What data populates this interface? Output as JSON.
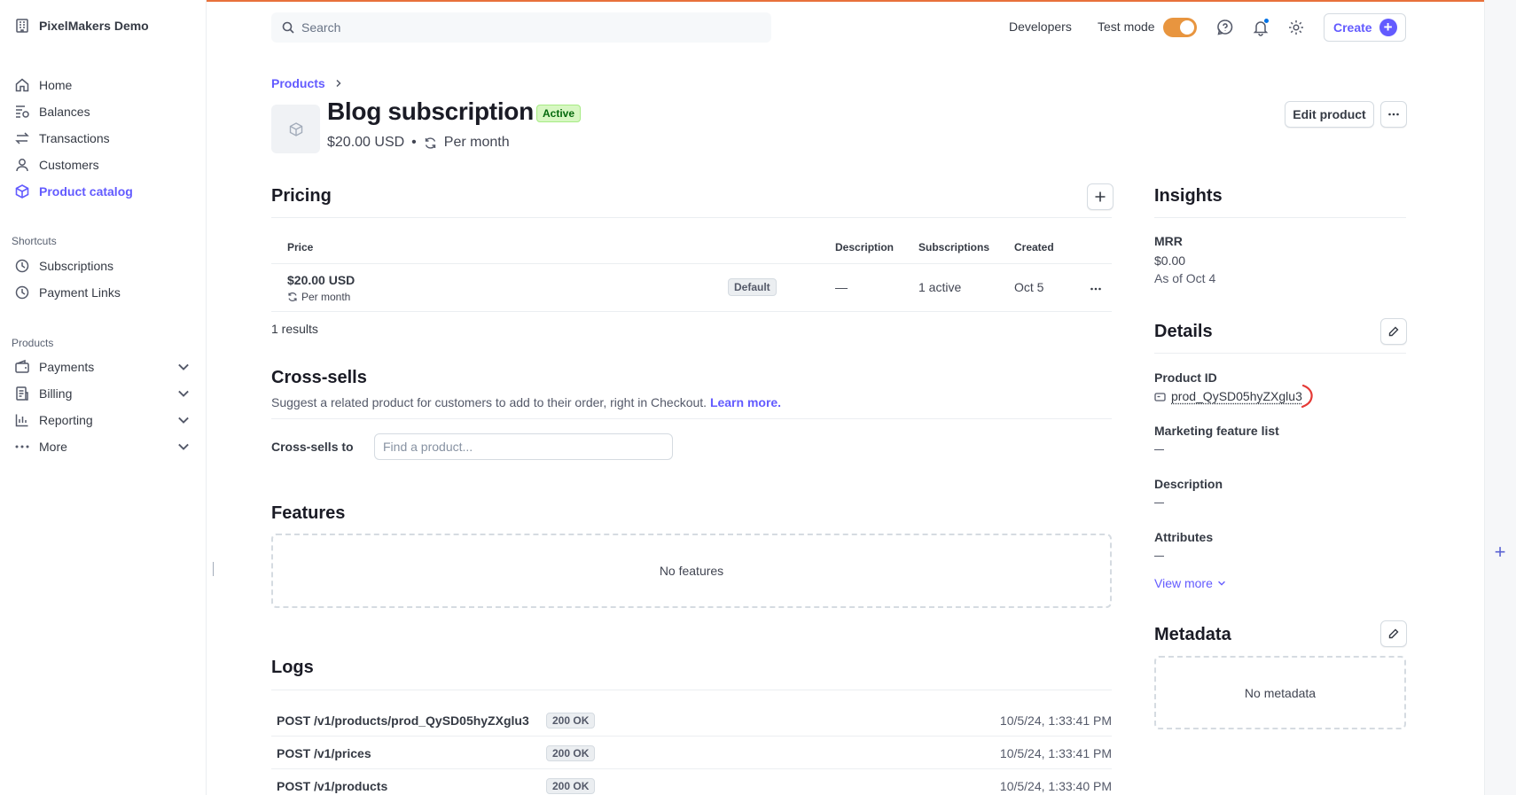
{
  "sidebar": {
    "account_name": "PixelMakers Demo",
    "items": [
      {
        "label": "Home",
        "icon": "home-icon"
      },
      {
        "label": "Balances",
        "icon": "balances-icon"
      },
      {
        "label": "Transactions",
        "icon": "transactions-icon"
      },
      {
        "label": "Customers",
        "icon": "customers-icon"
      },
      {
        "label": "Product catalog",
        "icon": "cube-icon",
        "active": true
      }
    ],
    "shortcuts_heading": "Shortcuts",
    "shortcuts": [
      {
        "label": "Subscriptions",
        "icon": "clock-icon"
      },
      {
        "label": "Payment Links",
        "icon": "clock-icon"
      }
    ],
    "products_heading": "Products",
    "products": [
      {
        "label": "Payments",
        "icon": "wallet-icon"
      },
      {
        "label": "Billing",
        "icon": "billing-icon"
      },
      {
        "label": "Reporting",
        "icon": "chart-icon"
      },
      {
        "label": "More",
        "icon": "more-dots-icon"
      }
    ]
  },
  "header": {
    "search_placeholder": "Search",
    "developers": "Developers",
    "test_mode": "Test mode",
    "create": "Create"
  },
  "product": {
    "breadcrumb": "Products",
    "title": "Blog subscription",
    "status": "Active",
    "price": "$20.00 USD",
    "interval": "Per month",
    "edit_button": "Edit product"
  },
  "pricing": {
    "heading": "Pricing",
    "columns": [
      "Price",
      "Description",
      "Subscriptions",
      "Created"
    ],
    "rows": [
      {
        "price": "$20.00 USD",
        "interval": "Per month",
        "badge": "Default",
        "description": "—",
        "subscriptions": "1 active",
        "created": "Oct 5"
      }
    ],
    "results": "1 results"
  },
  "cross_sells": {
    "heading": "Cross-sells",
    "description": "Suggest a related product for customers to add to their order, right in Checkout.",
    "learn_more": "Learn more.",
    "label": "Cross-sells to",
    "placeholder": "Find a product..."
  },
  "features": {
    "heading": "Features",
    "empty": "No features"
  },
  "logs": {
    "heading": "Logs",
    "rows": [
      {
        "path": "POST /v1/products/prod_QySD05hyZXglu3",
        "status": "200 OK",
        "time": "10/5/24, 1:33:41 PM"
      },
      {
        "path": "POST /v1/prices",
        "status": "200 OK",
        "time": "10/5/24, 1:33:41 PM"
      },
      {
        "path": "POST /v1/products",
        "status": "200 OK",
        "time": "10/5/24, 1:33:40 PM"
      }
    ]
  },
  "insights": {
    "heading": "Insights",
    "mrr_label": "MRR",
    "mrr_value": "$0.00",
    "mrr_date": "As of Oct 4"
  },
  "details": {
    "heading": "Details",
    "product_id_label": "Product ID",
    "product_id": "prod_QySD05hyZXglu3",
    "marketing_label": "Marketing feature list",
    "description_label": "Description",
    "attributes_label": "Attributes",
    "view_more": "View more"
  },
  "metadata": {
    "heading": "Metadata",
    "empty": "No metadata"
  },
  "colors": {
    "accent": "#635bff",
    "test_mode_toggle": "#e8953f",
    "active_badge_bg": "#d7f7c2",
    "top_border": "#e8713b"
  }
}
